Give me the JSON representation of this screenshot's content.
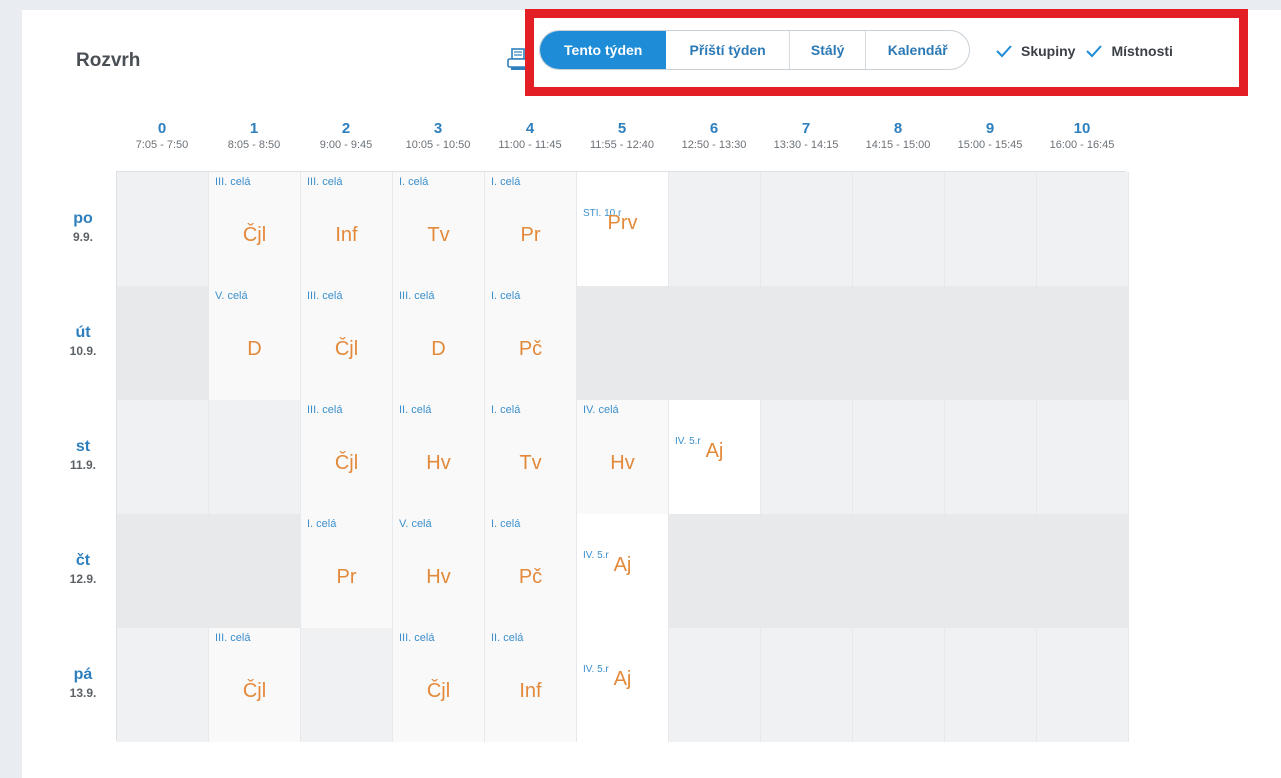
{
  "header": {
    "title": "Rozvrh",
    "tabs": [
      {
        "label": "Tento týden",
        "active": true
      },
      {
        "label": "Příští týden",
        "active": false
      },
      {
        "label": "Stálý",
        "active": false
      },
      {
        "label": "Kalendář",
        "active": false
      }
    ],
    "toggles": [
      {
        "label": "Skupiny",
        "checked": true
      },
      {
        "label": "Místnosti",
        "checked": true
      }
    ]
  },
  "colors": {
    "accent": "#1e8cd6",
    "subject": "#e3893a",
    "highlight": "#e41e25"
  },
  "hours": [
    {
      "num": "0",
      "time": "7:05 - 7:50"
    },
    {
      "num": "1",
      "time": "8:05 - 8:50"
    },
    {
      "num": "2",
      "time": "9:00 - 9:45"
    },
    {
      "num": "3",
      "time": "10:05 - 10:50"
    },
    {
      "num": "4",
      "time": "11:00 - 11:45"
    },
    {
      "num": "5",
      "time": "11:55 - 12:40"
    },
    {
      "num": "6",
      "time": "12:50 - 13:30"
    },
    {
      "num": "7",
      "time": "13:30 - 14:15"
    },
    {
      "num": "8",
      "time": "14:15 - 15:00"
    },
    {
      "num": "9",
      "time": "15:00 - 15:45"
    },
    {
      "num": "10",
      "time": "16:00 - 16:45"
    }
  ],
  "days": [
    {
      "name": "po",
      "date": "9.9.",
      "lessons": [
        null,
        {
          "group": "III. celá",
          "subject": "Čjl"
        },
        {
          "group": "III. celá",
          "subject": "Inf"
        },
        {
          "group": "I. celá",
          "subject": "Tv"
        },
        {
          "group": "I. celá",
          "subject": "Pr"
        },
        {
          "room": "STI. 10.r",
          "subject": "Prv"
        },
        null,
        null,
        null,
        null,
        null
      ]
    },
    {
      "name": "út",
      "date": "10.9.",
      "lessons": [
        null,
        {
          "group": "V. celá",
          "subject": "D"
        },
        {
          "group": "III. celá",
          "subject": "Čjl"
        },
        {
          "group": "III. celá",
          "subject": "D"
        },
        {
          "group": "I. celá",
          "subject": "Pč"
        },
        null,
        null,
        null,
        null,
        null,
        null
      ]
    },
    {
      "name": "st",
      "date": "11.9.",
      "lessons": [
        null,
        null,
        {
          "group": "III. celá",
          "subject": "Čjl"
        },
        {
          "group": "II. celá",
          "subject": "Hv"
        },
        {
          "group": "I. celá",
          "subject": "Tv"
        },
        {
          "group": "IV. celá",
          "subject": "Hv"
        },
        {
          "room": "IV. 5.r",
          "subject": "Aj"
        },
        null,
        null,
        null,
        null
      ]
    },
    {
      "name": "čt",
      "date": "12.9.",
      "lessons": [
        null,
        null,
        {
          "group": "I. celá",
          "subject": "Pr"
        },
        {
          "group": "V. celá",
          "subject": "Hv"
        },
        {
          "group": "I. celá",
          "subject": "Pč"
        },
        {
          "room": "IV. 5.r",
          "subject": "Aj"
        },
        null,
        null,
        null,
        null,
        null
      ]
    },
    {
      "name": "pá",
      "date": "13.9.",
      "lessons": [
        null,
        {
          "group": "III. celá",
          "subject": "Čjl"
        },
        null,
        {
          "group": "III. celá",
          "subject": "Čjl"
        },
        {
          "group": "II. celá",
          "subject": "Inf"
        },
        {
          "room": "IV. 5.r",
          "subject": "Aj"
        },
        null,
        null,
        null,
        null,
        null
      ]
    }
  ]
}
